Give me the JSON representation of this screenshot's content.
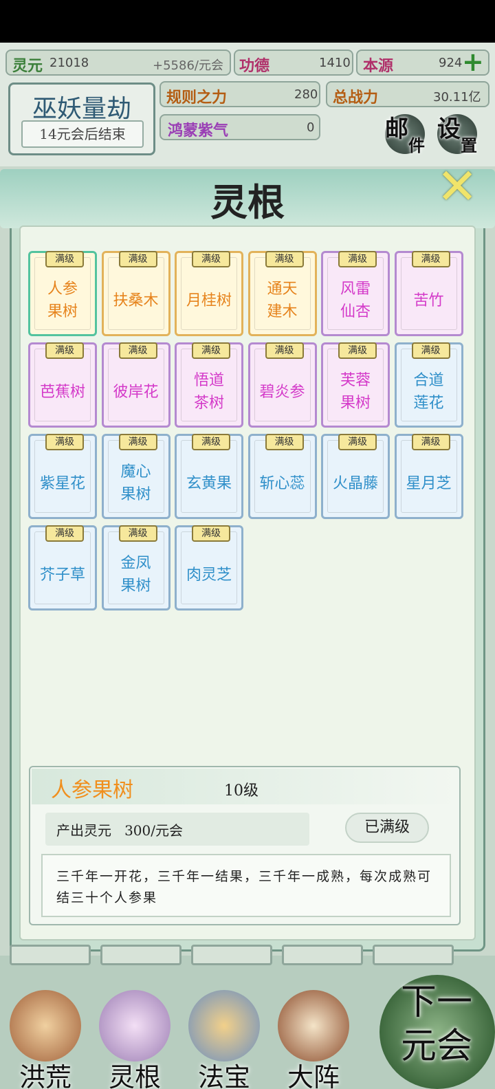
{
  "hud": {
    "lingyuan": {
      "label": "灵元",
      "value": "21018"
    },
    "rate": "+5586/元会",
    "gongde": {
      "label": "功德",
      "value": "1410"
    },
    "benyuan": {
      "label": "本源",
      "value": "924"
    },
    "guize": {
      "label": "规则之力",
      "value": "280"
    },
    "zhanli": {
      "label": "总战力",
      "value": "30.11亿"
    },
    "hongmeng": {
      "label": "鸿蒙紫气",
      "value": "0"
    },
    "boss": {
      "title": "巫妖量劫",
      "subtitle": "14元会后结束"
    },
    "mail": {
      "c1": "邮",
      "c2": "件"
    },
    "settings": {
      "c1": "设",
      "c2": "置"
    }
  },
  "panel": {
    "title": "灵根"
  },
  "badge_label": "满级",
  "cards": [
    {
      "name": "人参\n果树",
      "tier": "gold",
      "selected": true
    },
    {
      "name": "扶桑木",
      "tier": "gold"
    },
    {
      "name": "月桂树",
      "tier": "gold"
    },
    {
      "name": "通天\n建木",
      "tier": "gold"
    },
    {
      "name": "风雷\n仙杏",
      "tier": "purple"
    },
    {
      "name": "苦竹",
      "tier": "purple"
    },
    {
      "name": "芭蕉树",
      "tier": "purple"
    },
    {
      "name": "彼岸花",
      "tier": "purple"
    },
    {
      "name": "悟道\n茶树",
      "tier": "purple"
    },
    {
      "name": "碧炎参",
      "tier": "purple"
    },
    {
      "name": "芙蓉\n果树",
      "tier": "purple"
    },
    {
      "name": "合道\n莲花",
      "tier": "blue"
    },
    {
      "name": "紫星花",
      "tier": "blue"
    },
    {
      "name": "魔心\n果树",
      "tier": "blue"
    },
    {
      "name": "玄黄果",
      "tier": "blue"
    },
    {
      "name": "斩心蕊",
      "tier": "blue"
    },
    {
      "name": "火晶藤",
      "tier": "blue"
    },
    {
      "name": "星月芝",
      "tier": "blue"
    },
    {
      "name": "芥子草",
      "tier": "blue"
    },
    {
      "name": "金凤\n果树",
      "tier": "blue"
    },
    {
      "name": "肉灵芝",
      "tier": "blue"
    }
  ],
  "detail": {
    "name": "人参果树",
    "level": "10级",
    "yield": "产出灵元   300/元会",
    "maxed_button": "已满级",
    "description": "三千年一开花，三千年一结果，三千年一成熟，每次成熟可结三十个人参果"
  },
  "nav": [
    "洪荒",
    "灵根",
    "法宝",
    "大阵"
  ],
  "next_round": "下一\n元会",
  "colors": {
    "gold": "#e6831c",
    "purple": "#d43ac9",
    "blue": "#2f8fc9",
    "header_green": "#3b7f39"
  }
}
